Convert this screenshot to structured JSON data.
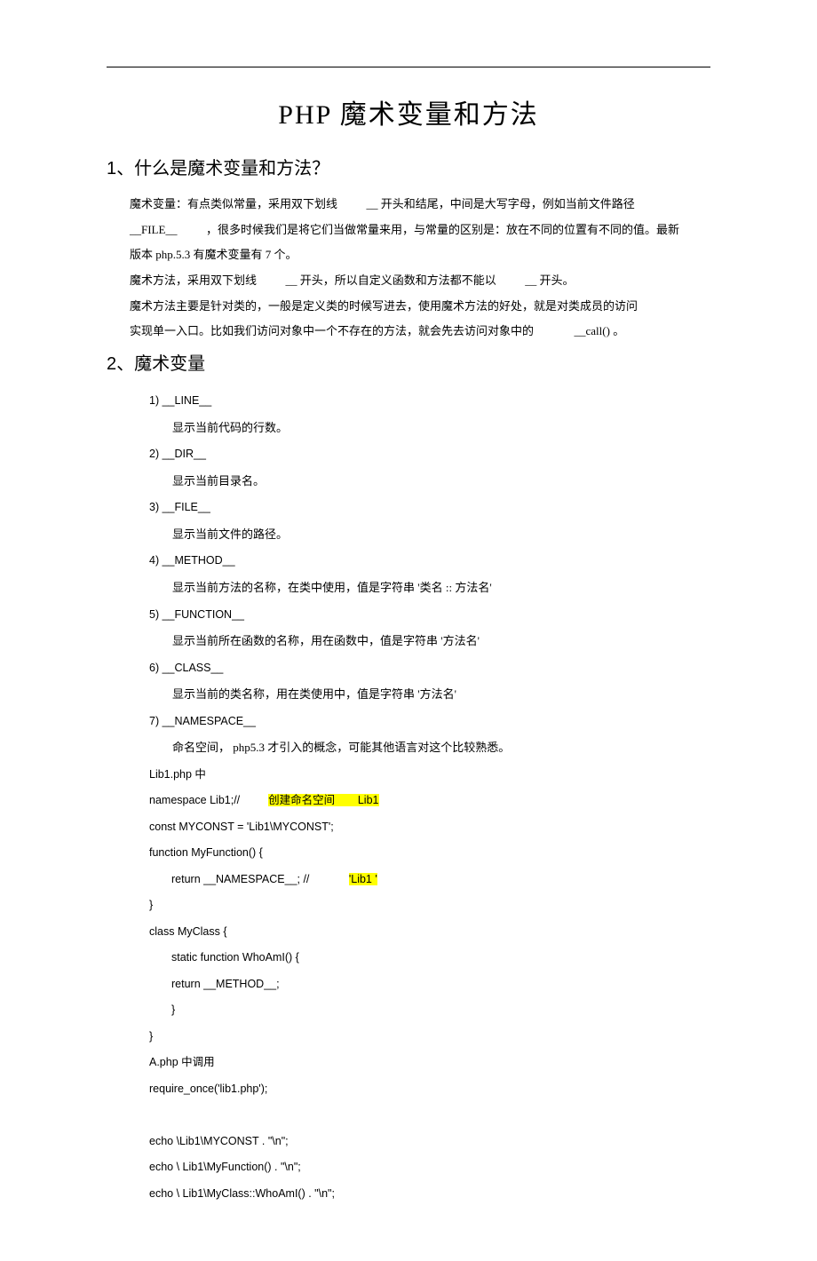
{
  "title": "PHP 魔术变量和方法",
  "section1": {
    "heading": "1、什么是魔术变量和方法？",
    "p1a": "魔术变量：有点类似常量，采用双下划线",
    "p1b": "__ 开头和结尾，中间是大写字母，例如当前文件路径",
    "p2a": "__FILE__",
    "p2b": "，很多时候我们是将它们当做常量来用，与常量的区别是：放在不同的位置有不同的值。最新",
    "p3": "版本 php.5.3    有魔术变量有    7 个。",
    "p4a": "魔术方法，采用双下划线",
    "p4b": "__ 开头，所以自定义函数和方法都不能以",
    "p4c": "__ 开头。",
    "p5": "魔术方法主要是针对类的，一般是定义类的时候写进去，使用魔术方法的好处，就是对类成员的访问",
    "p6a": "实现单一入口。比如我们访问对象中一个不存在的方法，就会先去访问对象中的",
    "p6b": "__call()  。"
  },
  "section2": {
    "heading": "2、魔术变量",
    "items": [
      {
        "label": "1) __LINE__",
        "desc": "显示当前代码的行数。"
      },
      {
        "label": "2) __DIR__",
        "desc": "显示当前目录名。"
      },
      {
        "label": "3) __FILE__",
        "desc": "显示当前文件的路径。"
      },
      {
        "label": "4) __METHOD__",
        "desc": "显示当前方法的名称，在类中使用，值是字符串 '类名        :: 方法名'"
      },
      {
        "label": "5) __FUNCTION__",
        "desc": "显示当前所在函数的名称，用在函数中，值是字符串 '方法名'"
      },
      {
        "label": "6) __CLASS__",
        "desc": "显示当前的类名称，用在类使用中，值是字符串 '方法名'"
      },
      {
        "label": "7) __NAMESPACE__",
        "desc": "命名空间，   php5.3    才引入的概念，可能其他语言对这个比较熟悉。"
      }
    ]
  },
  "code": {
    "c01": "Lib1.php    中",
    "c02a": "namespace Lib1;//",
    "c02b": "创建命名空间",
    "c02c": "Lib1",
    "c03": "const MYCONST = 'Lib1\\MYCONST';",
    "c04": "function MyFunction() {",
    "c05a": "return  __NAMESPACE__; //",
    "c05b": "'Lib1  '",
    "c06": "}",
    "c07": "class MyClass {",
    "c08": "static function WhoAmI() {",
    "c09": "return __METHOD__;",
    "c10": "}",
    "c11": "}",
    "c12": "A.php   中调用",
    "c13": "require_once('lib1.php');",
    "c14": "",
    "c15": "echo \\Lib1\\MYCONST . \"\\n\";",
    "c16": "echo \\ Lib1\\MyFunction() . \"\\n\";",
    "c17": "echo \\ Lib1\\MyClass::WhoAmI() . \"\\n\";"
  }
}
